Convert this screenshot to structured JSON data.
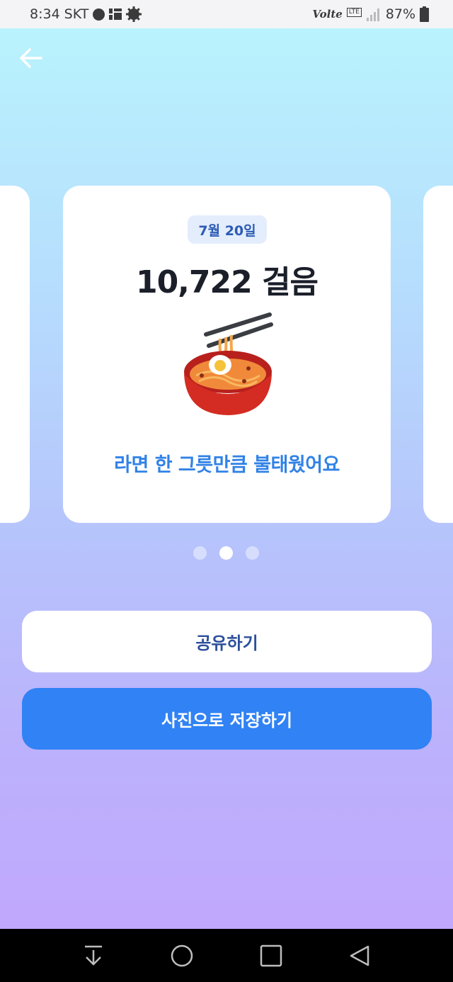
{
  "status_bar": {
    "time": "8:34",
    "carrier": "SKT",
    "volte": "Volte",
    "lte": "LTE",
    "battery": "87%"
  },
  "card": {
    "date": "7월 20일",
    "steps": "10,722 걸음",
    "icon": "ramen-bowl-icon",
    "message": "라면 한 그릇만큼 불태웠어요"
  },
  "pager": {
    "total": 3,
    "active": 2
  },
  "buttons": {
    "share": "공유하기",
    "save": "사진으로 저장하기"
  },
  "colors": {
    "accent": "#3182f4",
    "message": "#3182e6",
    "date_badge_bg": "#e3edfb"
  }
}
